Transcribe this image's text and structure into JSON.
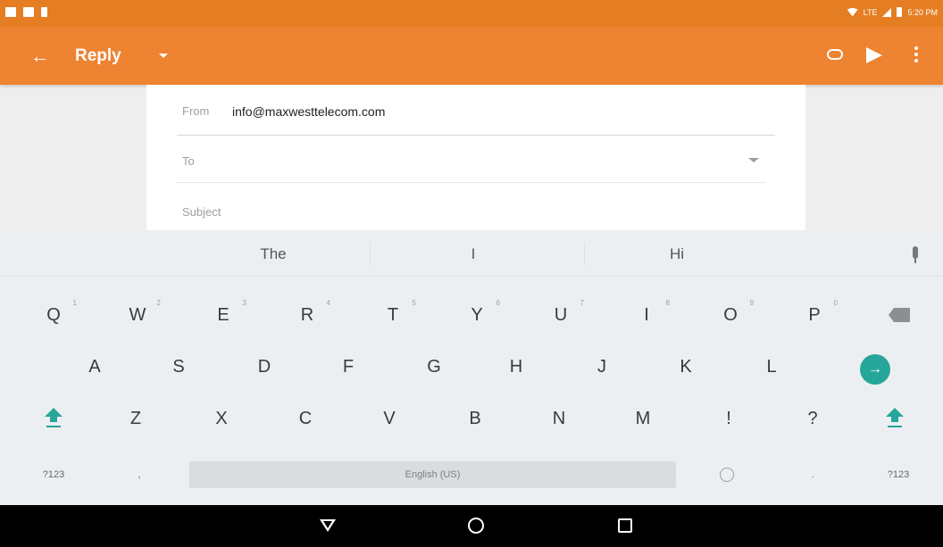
{
  "status_bar": {
    "time": "5:20 PM",
    "network": "LTE"
  },
  "app_bar": {
    "title": "Reply",
    "icons": [
      "back-arrow-icon",
      "dropdown-icon",
      "attach-icon",
      "send-icon",
      "more-vert-icon"
    ]
  },
  "compose": {
    "from_label": "From",
    "from_value": "info@maxwesttelecom.com",
    "to_label": "To",
    "subject_label": "Subject"
  },
  "suggestions": [
    "The",
    "I",
    "Hi"
  ],
  "keyboard": {
    "row1": [
      {
        "key": "Q",
        "hint": "1"
      },
      {
        "key": "W",
        "hint": "2"
      },
      {
        "key": "E",
        "hint": "3"
      },
      {
        "key": "R",
        "hint": "4"
      },
      {
        "key": "T",
        "hint": "5"
      },
      {
        "key": "Y",
        "hint": "6"
      },
      {
        "key": "U",
        "hint": "7"
      },
      {
        "key": "I",
        "hint": "8"
      },
      {
        "key": "O",
        "hint": "9"
      },
      {
        "key": "P",
        "hint": "0"
      }
    ],
    "row2": [
      "A",
      "S",
      "D",
      "F",
      "G",
      "H",
      "J",
      "K",
      "L"
    ],
    "row3": [
      "Z",
      "X",
      "C",
      "V",
      "B",
      "N",
      "M",
      "!",
      "?"
    ],
    "symbols_left": "?123",
    "comma": ",",
    "space_label": "English (US)",
    "period": ".",
    "symbols_right": "?123",
    "enter_symbol": "→"
  },
  "colors": {
    "status_bar": "#e57d22",
    "app_bar": "#ee8331",
    "accent": "#26a69a"
  }
}
